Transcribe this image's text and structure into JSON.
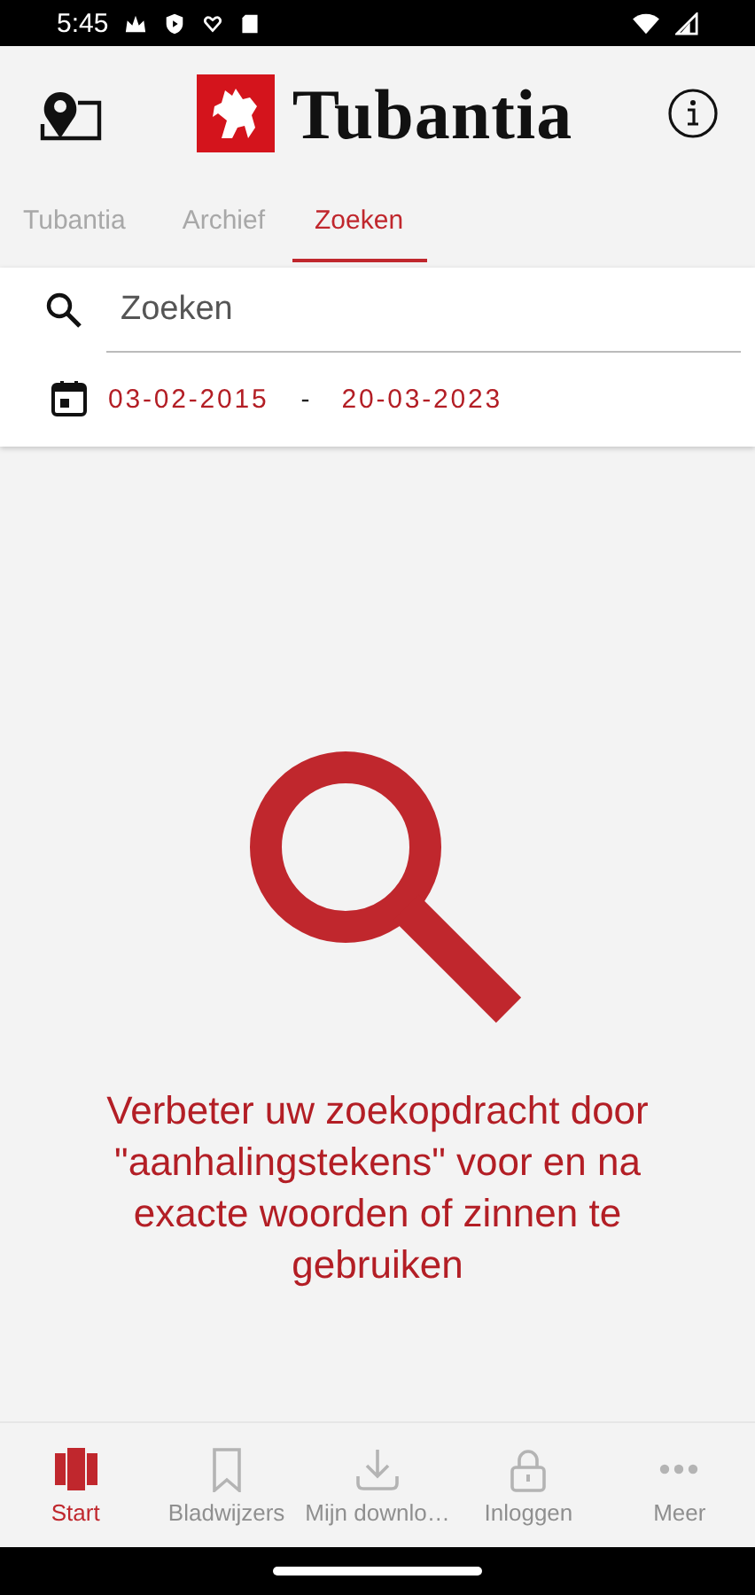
{
  "status_bar": {
    "time": "5:45"
  },
  "header": {
    "brand": "Tubantia"
  },
  "tabs": [
    {
      "label": "Tubantia",
      "selected": false
    },
    {
      "label": "Archief",
      "selected": false
    },
    {
      "label": "Zoeken",
      "selected": true
    }
  ],
  "search": {
    "placeholder": "Zoeken"
  },
  "date_range": {
    "from": "03-02-2015",
    "separator": "-",
    "to": "20-03-2023"
  },
  "hint": "Verbeter uw zoekopdracht door \"aanhalingstekens\" voor en na exacte woorden of zinnen te gebruiken",
  "bottom_nav": [
    {
      "kind": "start",
      "label": "Start",
      "selected": true
    },
    {
      "kind": "bookmark",
      "label": "Bladwijzers",
      "selected": false
    },
    {
      "kind": "download",
      "label": "Mijn downlo…",
      "selected": false
    },
    {
      "kind": "lock",
      "label": "Inloggen",
      "selected": false
    },
    {
      "kind": "more",
      "label": "Meer",
      "selected": false
    }
  ]
}
